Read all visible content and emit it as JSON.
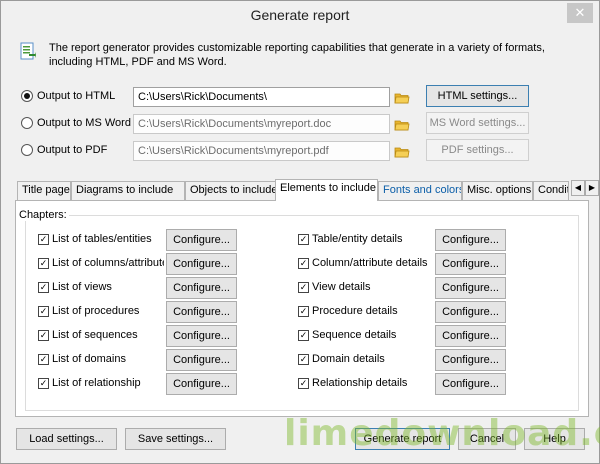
{
  "window": {
    "title": "Generate report",
    "close_symbol": "✕"
  },
  "intro": {
    "text": "The report generator provides customizable reporting capabilities that generate in a variety of formats, including HTML, PDF and MS Word."
  },
  "outputs": [
    {
      "label": "Output to HTML",
      "path": "C:\\Users\\Rick\\Documents\\",
      "button": "HTML settings...",
      "checked": true
    },
    {
      "label": "Output to MS Word",
      "path": "C:\\Users\\Rick\\Documents\\myreport.doc",
      "button": "MS Word settings...",
      "checked": false
    },
    {
      "label": "Output to PDF",
      "path": "C:\\Users\\Rick\\Documents\\myreport.pdf",
      "button": "PDF settings...",
      "checked": false
    }
  ],
  "tabs": [
    "Title page",
    "Diagrams to include",
    "Objects to include",
    "Elements to include",
    "Fonts and colors",
    "Misc. options",
    "Condit"
  ],
  "tab_scroll": {
    "left": "◀",
    "right": "▶"
  },
  "chapters": {
    "label": "Chapters:",
    "configure_label": "Configure...",
    "left": [
      "List of tables/entities",
      "List of columns/attributes",
      "List of views",
      "List of procedures",
      "List of sequences",
      "List of domains",
      "List of relationship"
    ],
    "right": [
      "Table/entity details",
      "Column/attribute details",
      "View details",
      "Procedure details",
      "Sequence details",
      "Domain details",
      "Relationship details"
    ],
    "check_mark": "✓"
  },
  "footer": {
    "load": "Load settings...",
    "save": "Save settings...",
    "generate": "Generate report",
    "cancel": "Cancel",
    "help": "Help"
  },
  "watermark": "limedownload.com",
  "colors": {
    "accent": "#3c7fb1",
    "watermark": "#7db928"
  }
}
